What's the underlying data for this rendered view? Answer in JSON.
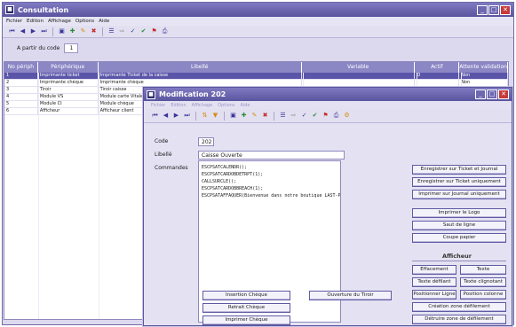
{
  "main_window": {
    "title": "Consultation",
    "menu": [
      "Fichier",
      "Edition",
      "Affichage",
      "Options",
      "Aide"
    ],
    "filter_label": "A partir du code",
    "filter_value": "1"
  },
  "grid": {
    "headers": [
      "No périph",
      "Périphérique",
      "Libellé",
      "Variable",
      "Actif",
      "Attente validation"
    ],
    "rows": [
      {
        "no": "1",
        "name": "Imprimante ticket",
        "label": "Imprimante Ticket de la caisse",
        "variable": "",
        "actif": "O",
        "attente": "Non"
      },
      {
        "no": "2",
        "name": "Imprimante chèque",
        "label": "Imprimante chèque",
        "variable": "",
        "actif": "",
        "attente": "Non"
      },
      {
        "no": "3",
        "name": "Tiroir",
        "label": "Tiroir caisse",
        "variable": "",
        "actif": "",
        "attente": ""
      },
      {
        "no": "4",
        "name": "Module VS",
        "label": "Module carte Vitale",
        "variable": "",
        "actif": "",
        "attente": ""
      },
      {
        "no": "5",
        "name": "Module CI",
        "label": "Module chèque",
        "variable": "",
        "actif": "",
        "attente": ""
      },
      {
        "no": "6",
        "name": "Afficheur",
        "label": "Afficheur client",
        "variable": "",
        "actif": "",
        "attente": ""
      }
    ]
  },
  "modal": {
    "title": "Modification  202",
    "light_menu": [
      "Fichier",
      "Edition",
      "Affichage",
      "Options",
      "Aide"
    ],
    "code_label": "Code",
    "code_value": "202",
    "libelle_label": "Libellé",
    "libelle_value": "Caisse Ouverte",
    "commandes_label": "Commandes",
    "commands_text": "ESCPSATCALENDR();\nESCPSATCARDOBDETRPT(1);\nCALLSURCLE();\nESCPSATCARDOBBREACH(1);\nESCPSATAFFAQUER(Bienvenue dans notre boutique LAST-Pool);",
    "buttons": {
      "enr_ticket_journal": "Enregistrer sur Ticket et Journal",
      "enr_ticket_seul": "Enregistrer sur Ticket uniquement",
      "imprimer_journal": "Imprimer sur Journal uniquement",
      "imprimer_logo": "Imprimer le Logo",
      "saut_ligne": "Saut de ligne",
      "coupe_papier": "Coupe papier",
      "insertion_cheque": "Insertion Chèque",
      "retrait_cheque": "Retrait Chèque",
      "imprimer_cheque": "Imprimer Chèque",
      "ouverture_tiroir": "Ouverture du Tiroir"
    },
    "afficheur": {
      "title": "Afficheur",
      "effacement": "Effacement",
      "texte": "Texte",
      "texte_defilant": "Texte défilant",
      "texte_clignotant": "Texte clignotant",
      "positionner_ligne": "Positionner Ligne",
      "position_colonne": "Position colonne",
      "creation_zone": "Création zone défilement",
      "detruire_zone": "Détruire zone de défilement"
    }
  },
  "icons": [
    "first-icon",
    "prev-icon",
    "next-icon",
    "last-icon",
    "new-icon",
    "add-icon",
    "edit-icon",
    "delete-icon",
    "list-icon",
    "export-icon",
    "check-icon",
    "validate-icon",
    "flag-icon",
    "print-icon"
  ],
  "colors": {
    "header_bg": "#8b86c4",
    "title_bg": "#5a559e",
    "selection": "#5a55a8"
  }
}
